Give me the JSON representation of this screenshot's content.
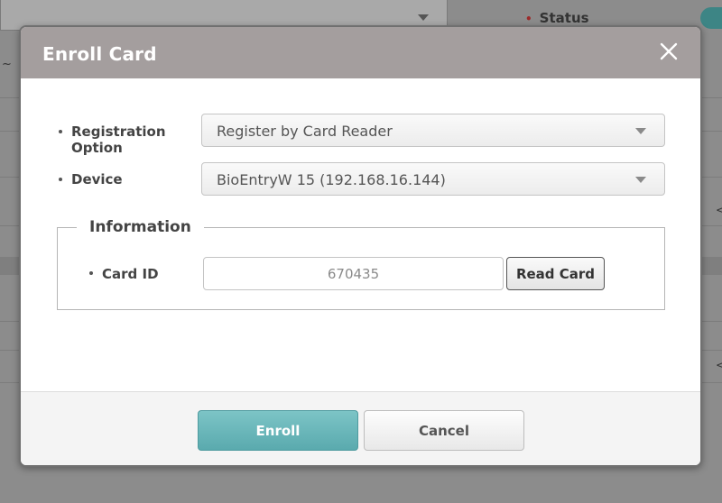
{
  "background": {
    "status_label": "Status",
    "required_mark": "•",
    "tilde": "~",
    "arrow_glyph": "<"
  },
  "dialog": {
    "title": "Enroll Card",
    "close_glyph": "×",
    "registration_option": {
      "label": "Registration Option",
      "value": "Register by Card Reader"
    },
    "device": {
      "label": "Device",
      "value": "BioEntryW 15 (192.168.16.144)"
    },
    "information": {
      "legend": "Information",
      "card_id_label": "Card ID",
      "card_id_value": "670435",
      "read_card_label": "Read Card"
    },
    "buttons": {
      "enroll": "Enroll",
      "cancel": "Cancel"
    }
  },
  "colors": {
    "header": "#a49e9e",
    "enroll_button": "#6bb8bb",
    "overlay": "#8c8c8c"
  }
}
